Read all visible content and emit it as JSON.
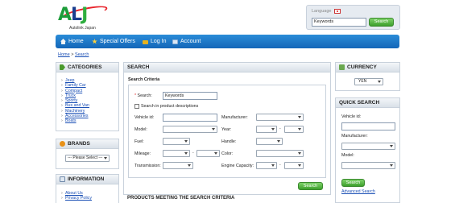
{
  "header": {
    "logo_text": "ALJ",
    "logo_subtitle": "Autolink Japan",
    "language_label": "Language",
    "search_value": "Keywords",
    "search_button": "Search"
  },
  "nav": [
    {
      "label": "Home",
      "icon": "home-icon"
    },
    {
      "label": "Special Offers",
      "icon": "star-icon"
    },
    {
      "label": "Log In",
      "icon": "lock-icon"
    },
    {
      "label": "Account",
      "icon": "account-icon"
    }
  ],
  "breadcrumb": {
    "home": "Home",
    "separator": " > ",
    "current": "Search"
  },
  "categories": {
    "title": "CATEGORIES",
    "items": [
      "Jeep",
      "Family Car",
      "Compact",
      "Truck",
      "Sporty",
      "Bus and Van",
      "Machinery",
      "Accessories",
      "Boats"
    ]
  },
  "brands": {
    "title": "BRANDS",
    "select_value": "--- Please Select ---"
  },
  "information": {
    "title": "INFORMATION",
    "items": [
      "About Us",
      "Privacy Policy"
    ]
  },
  "search": {
    "title": "SEARCH",
    "criteria_title": "Search Criteria",
    "search_label": "Search:",
    "search_required": "*",
    "search_value": "Keywords",
    "desc_checkbox_label": "Search in product descriptions",
    "vehicle_id_label": "Vehicle id:",
    "manufacturer_label": "Manufacturer:",
    "model_label": "Model:",
    "year_label": "Year:",
    "fuel_label": "Fuel:",
    "handle_label": "Handle:",
    "mileage_label": "Mileage:",
    "color_label": "Color:",
    "transmission_label": "Transmission:",
    "engine_label": "Engine Capacity:",
    "range_dash": "-",
    "button": "Search"
  },
  "results_title": "PRODUCTS MEETING THE SEARCH CRITERIA",
  "currency": {
    "title": "CURRENCY",
    "value": "YEN"
  },
  "quick_search": {
    "title": "QUICK SEARCH",
    "vehicle_id_label": "Vehicle id:",
    "manufacturer_label": "Manufacturer:",
    "model_label": "Model:",
    "button": "Search",
    "advanced_link": "Advanced Search"
  },
  "colors": {
    "nav_blue": "#1c78cc",
    "button_green": "#4aae35",
    "link_blue": "#1a4fb5"
  }
}
